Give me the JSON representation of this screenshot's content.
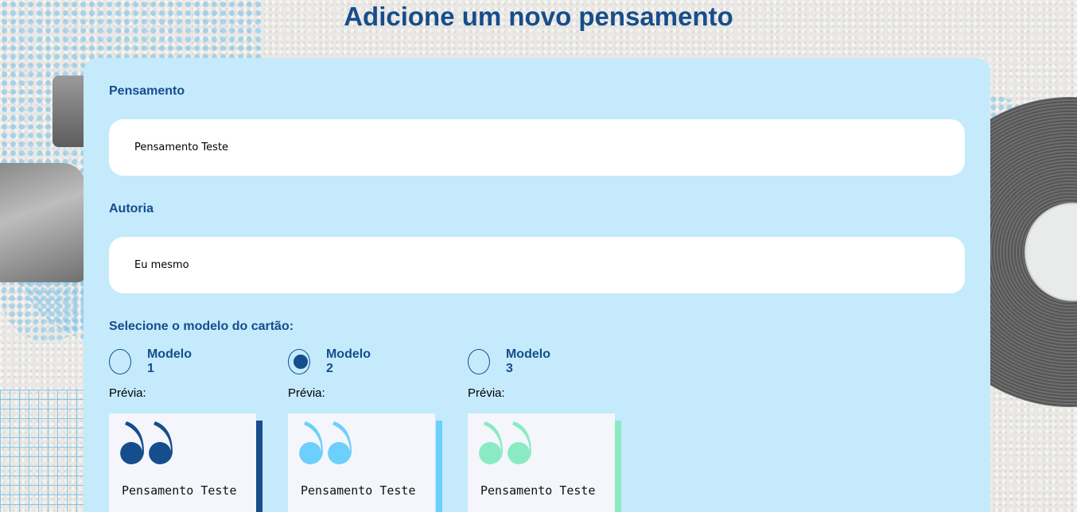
{
  "page_title": "Adicione um novo pensamento",
  "form": {
    "pensamento_label": "Pensamento",
    "pensamento_value": "Pensamento Teste",
    "autoria_label": "Autoria",
    "autoria_value": "Eu mesmo",
    "modelo_label": "Selecione o modelo do cartão:"
  },
  "models": [
    {
      "label": "Modelo 1",
      "selected": false,
      "preview_label": "Prévia:",
      "preview_text": "Pensamento Teste",
      "color": "#164d8c"
    },
    {
      "label": "Modelo 2",
      "selected": true,
      "preview_label": "Prévia:",
      "preview_text": "Pensamento Teste",
      "color": "#6dcffb"
    },
    {
      "label": "Modelo 3",
      "selected": false,
      "preview_label": "Prévia:",
      "preview_text": "Pensamento Teste",
      "color": "#8aebc3"
    }
  ],
  "icons": {
    "quote": "quote-icon",
    "radio": "radio-button"
  },
  "colors": {
    "primary": "#164d8c",
    "card_bg": "#c4eafc",
    "input_bg": "#ffffff"
  }
}
